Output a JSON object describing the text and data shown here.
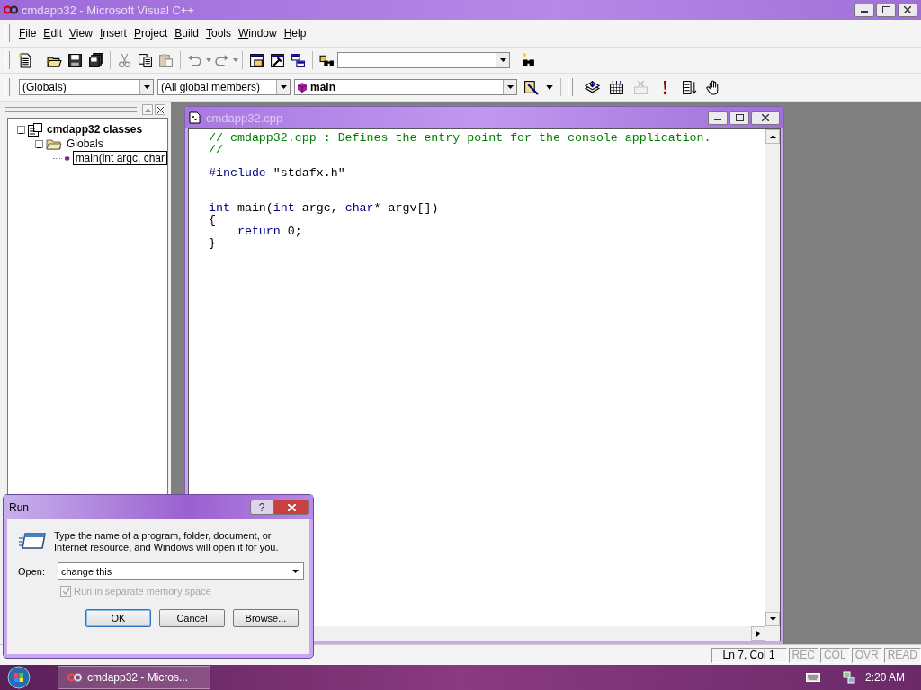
{
  "window": {
    "title": "cmdapp32 - Microsoft Visual C++"
  },
  "menu": [
    {
      "label": "File"
    },
    {
      "label": "Edit"
    },
    {
      "label": "View"
    },
    {
      "label": "Insert"
    },
    {
      "label": "Project"
    },
    {
      "label": "Build"
    },
    {
      "label": "Tools"
    },
    {
      "label": "Window"
    },
    {
      "label": "Help"
    }
  ],
  "standard_toolbar": {
    "buttons": [
      {
        "kind": "new",
        "disabled": false
      },
      {
        "kind": "open",
        "disabled": false
      },
      {
        "kind": "save",
        "disabled": false
      },
      {
        "kind": "save-all",
        "disabled": false
      },
      {
        "kind": "cut",
        "disabled": true
      },
      {
        "kind": "copy",
        "disabled": false
      },
      {
        "kind": "paste",
        "disabled": true
      },
      {
        "kind": "undo",
        "disabled": true
      },
      {
        "kind": "redo",
        "disabled": true
      },
      {
        "kind": "workspace",
        "disabled": false
      },
      {
        "kind": "output",
        "disabled": false
      },
      {
        "kind": "windows",
        "disabled": false
      },
      {
        "kind": "find-files",
        "disabled": false
      },
      {
        "kind": "find-combo"
      },
      {
        "kind": "search",
        "disabled": false
      }
    ]
  },
  "wizard_toolbar": {
    "combos": [
      {
        "value": "(Globals)",
        "kind": "plain"
      },
      {
        "value": "(All global members)",
        "kind": "plain"
      },
      {
        "value": "main",
        "kind": "function"
      }
    ]
  },
  "build_toolbar": {
    "buttons": [
      {
        "kind": "compile",
        "disabled": false
      },
      {
        "kind": "build",
        "disabled": false
      },
      {
        "kind": "stop",
        "disabled": true
      },
      {
        "kind": "execute",
        "disabled": false
      },
      {
        "kind": "go",
        "disabled": false
      },
      {
        "kind": "breakpoint",
        "disabled": false
      }
    ]
  },
  "workspace": {
    "items": [
      {
        "label": "cmdapp32 classes",
        "kind": "project",
        "expanded": true,
        "selected": false,
        "children": [
          {
            "label": "Globals",
            "kind": "folder",
            "expanded": true,
            "selected": false,
            "children": [
              {
                "label": "main(int argc, char",
                "kind": "function",
                "selected": true
              }
            ]
          }
        ]
      }
    ]
  },
  "editor": {
    "title": "cmdapp32.cpp",
    "lines": [
      {
        "kind": "code",
        "tokens": [
          {
            "text": "// cmdapp32.cpp : Defines the entry point for the console application.",
            "kind": "comment"
          }
        ]
      },
      {
        "kind": "code",
        "tokens": [
          {
            "text": "//",
            "kind": "comment"
          }
        ]
      },
      {
        "kind": "blank"
      },
      {
        "kind": "code",
        "tokens": [
          {
            "text": "#include",
            "kind": "keyword"
          },
          {
            "text": " \"stdafx.h\"",
            "kind": "plain"
          }
        ]
      },
      {
        "kind": "blank"
      },
      {
        "kind": "blank"
      },
      {
        "kind": "code",
        "tokens": [
          {
            "text": "int",
            "kind": "keyword"
          },
          {
            "text": " main(",
            "kind": "plain"
          },
          {
            "text": "int",
            "kind": "keyword"
          },
          {
            "text": " argc, ",
            "kind": "plain"
          },
          {
            "text": "char",
            "kind": "keyword"
          },
          {
            "text": "* argv[])",
            "kind": "plain"
          }
        ]
      },
      {
        "kind": "code",
        "tokens": [
          {
            "text": "{",
            "kind": "plain"
          }
        ]
      },
      {
        "kind": "code",
        "tokens": [
          {
            "text": "    return",
            "kind": "keyword"
          },
          {
            "text": " 0;",
            "kind": "plain"
          }
        ]
      },
      {
        "kind": "code",
        "tokens": [
          {
            "text": "}",
            "kind": "plain"
          }
        ]
      }
    ]
  },
  "status_bar": {
    "panes": [
      {
        "text": "Ln 7, Col 1",
        "disabled": false
      },
      {
        "text": "REC",
        "disabled": true
      },
      {
        "text": "COL",
        "disabled": true
      },
      {
        "text": "OVR",
        "disabled": true
      },
      {
        "text": "READ",
        "disabled": true
      }
    ]
  },
  "taskbar": {
    "tasks": [
      {
        "label": "cmdapp32 - Micros...",
        "selected": false
      }
    ],
    "clock": "2:20 AM"
  },
  "run_dialog": {
    "title": "Run",
    "help": "?",
    "message": "Type the name of a program, folder, document, or Internet resource, and Windows will open it for you.",
    "open_label": "Open:",
    "value": "change this",
    "option": {
      "label": "Run in separate memory space",
      "checked": true,
      "disabled": true
    },
    "buttons": [
      {
        "label": "OK",
        "default": true
      },
      {
        "label": "Cancel",
        "default": false
      },
      {
        "label": "Browse...",
        "default": false
      }
    ]
  }
}
